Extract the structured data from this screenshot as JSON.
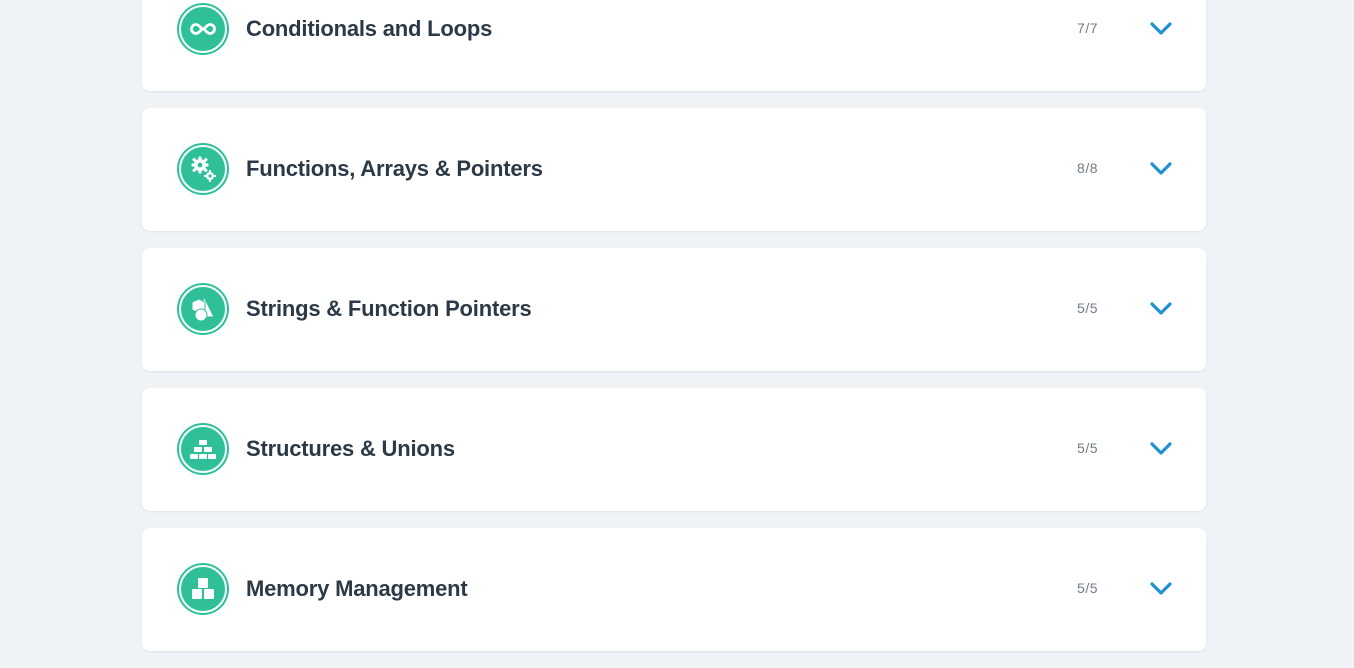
{
  "accent_color": "#2fbf99",
  "chevron_color": "#1e90d8",
  "sections": [
    {
      "title": "Conditionals and Loops",
      "progress": "7/7",
      "icon": "infinity-icon"
    },
    {
      "title": "Functions, Arrays & Pointers",
      "progress": "8/8",
      "icon": "gears-icon"
    },
    {
      "title": "Strings & Function Pointers",
      "progress": "5/5",
      "icon": "shapes-icon"
    },
    {
      "title": "Structures & Unions",
      "progress": "5/5",
      "icon": "blocks-stack-icon"
    },
    {
      "title": "Memory Management",
      "progress": "5/5",
      "icon": "boxes-icon"
    }
  ]
}
